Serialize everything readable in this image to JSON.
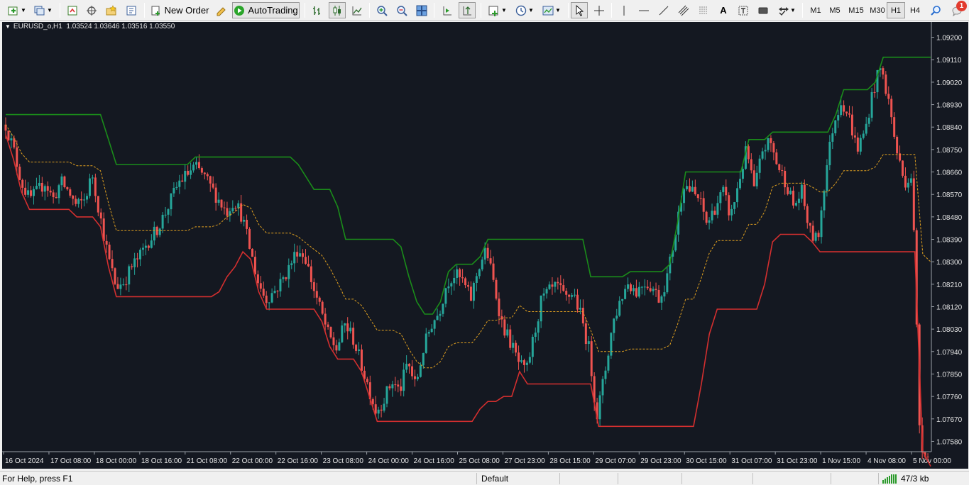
{
  "toolbar": {
    "new_order": "New Order",
    "autotrading": "AutoTrading",
    "timeframes": [
      "M1",
      "M5",
      "M15",
      "M30",
      "H1",
      "H4"
    ],
    "active_timeframe": "H1",
    "notification_count": "1",
    "icons": [
      "new-chart-icon",
      "profiles-icon",
      "market-watch-icon",
      "navigator-icon",
      "favorites-icon",
      "terminal-icon",
      "new-order-icon",
      "metaeditor-icon",
      "autotrading-icon",
      "bar-chart-icon",
      "candlestick-icon",
      "line-chart-icon",
      "zoom-in-icon",
      "zoom-out-icon",
      "tile-windows-icon",
      "chart-shift-icon",
      "autoscroll-icon",
      "indicators-icon",
      "periods-icon",
      "templates-icon",
      "cursor-icon",
      "crosshair-icon",
      "vertical-line-icon",
      "horizontal-line-icon",
      "trendline-icon",
      "equidistant-channel-icon",
      "fibonacci-icon",
      "text-icon",
      "text-label-icon",
      "rectangle-icon",
      "arrows-icon",
      "search-icon",
      "notifications-icon"
    ]
  },
  "chart": {
    "header": "EURUSD_o,H1  1.03524 1.03646 1.03516 1.03550",
    "background": "#141821",
    "bull_color": "#26a69a",
    "bear_color": "#ef5350",
    "upper_color": "#1a8c1a",
    "lower_color": "#d32f2f",
    "mid_color": "#e0a020"
  },
  "chart_data": {
    "type": "candlestick",
    "symbol": "EURUSD_o",
    "timeframe": "H1",
    "ohlc": {
      "open": 1.03524,
      "high": 1.03646,
      "low": 1.03516,
      "close": 1.0355
    },
    "ylim": [
      1.0755,
      1.0925
    ],
    "y_ticks": [
      "1.09200",
      "1.09110",
      "1.09020",
      "1.08930",
      "1.08840",
      "1.08750",
      "1.08660",
      "1.08570",
      "1.08480",
      "1.08390",
      "1.08300",
      "1.08210",
      "1.08120",
      "1.08030",
      "1.07940",
      "1.07850",
      "1.07760",
      "1.07670",
      "1.07580"
    ],
    "x_ticks": [
      "16 Oct 2024",
      "17 Oct 08:00",
      "18 Oct 00:00",
      "18 Oct 16:00",
      "21 Oct 08:00",
      "22 Oct 00:00",
      "22 Oct 16:00",
      "23 Oct 08:00",
      "24 Oct 00:00",
      "24 Oct 16:00",
      "25 Oct 08:00",
      "27 Oct 23:00",
      "28 Oct 15:00",
      "29 Oct 07:00",
      "29 Oct 23:00",
      "30 Oct 15:00",
      "31 Oct 07:00",
      "31 Oct 23:00",
      "1 Nov 15:00",
      "4 Nov 08:00",
      "5 Nov 00:00"
    ],
    "close_path": [
      1.0885,
      1.0875,
      1.0862,
      1.0855,
      1.0858,
      1.0862,
      1.0855,
      1.0862,
      1.0858,
      1.0852,
      1.0855,
      1.0865,
      1.0848,
      1.0832,
      1.082,
      1.0822,
      1.0828,
      1.0832,
      1.0838,
      1.0842,
      1.0848,
      1.0855,
      1.0862,
      1.0865,
      1.0868,
      1.0865,
      1.086,
      1.0855,
      1.085,
      1.0855,
      1.0848,
      1.0835,
      1.0822,
      1.0815,
      1.0818,
      1.0822,
      1.0828,
      1.0835,
      1.0832,
      1.082,
      1.081,
      1.08,
      1.0795,
      1.0805,
      1.08,
      1.079,
      1.078,
      1.077,
      1.0775,
      1.0782,
      1.0778,
      1.079,
      1.078,
      1.0795,
      1.0805,
      1.081,
      1.0822,
      1.0825,
      1.0822,
      1.0815,
      1.0828,
      1.0835,
      1.082,
      1.0805,
      1.0798,
      1.079,
      1.0785,
      1.08,
      1.0815,
      1.0818,
      1.082,
      1.0815,
      1.0818,
      1.0808,
      1.0795,
      1.0768,
      1.0785,
      1.0805,
      1.0815,
      1.0822,
      1.0818,
      1.0822,
      1.082,
      1.0815,
      1.0825,
      1.0842,
      1.0862,
      1.0858,
      1.0855,
      1.0845,
      1.0852,
      1.0858,
      1.0848,
      1.0862,
      1.0875,
      1.0858,
      1.0875,
      1.0878,
      1.0868,
      1.0862,
      1.0852,
      1.0858,
      1.0842,
      1.0838,
      1.0865,
      1.0885,
      1.0895,
      1.0888,
      1.0875,
      1.0882,
      1.0898,
      1.0908,
      1.0895,
      1.0875,
      1.0862,
      1.0865,
      1.0758,
      1.0752
    ]
  },
  "status": {
    "help": "For Help, press F1",
    "profile": "Default",
    "traffic": "47/3 kb"
  }
}
